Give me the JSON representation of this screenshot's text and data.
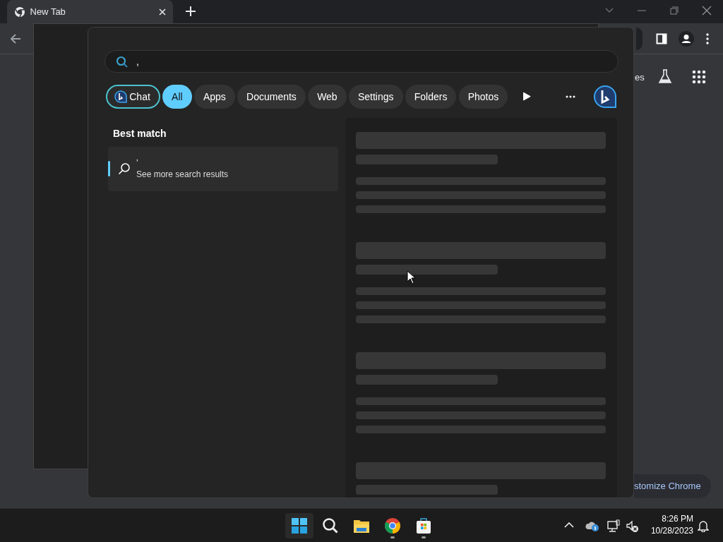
{
  "browser": {
    "tabs": [
      {
        "title": "New Tab",
        "selected": true
      }
    ],
    "partial_label": "es",
    "customize_button": "stomize Chrome"
  },
  "search": {
    "query": ",",
    "filters": [
      {
        "label": "Chat",
        "kind": "chat",
        "selected": false
      },
      {
        "label": "All",
        "kind": "plain",
        "selected": true
      },
      {
        "label": "Apps",
        "kind": "plain",
        "selected": false
      },
      {
        "label": "Documents",
        "kind": "plain",
        "selected": false
      },
      {
        "label": "Web",
        "kind": "plain",
        "selected": false
      },
      {
        "label": "Settings",
        "kind": "plain",
        "selected": false
      },
      {
        "label": "Folders",
        "kind": "plain",
        "selected": false
      },
      {
        "label": "Photos",
        "kind": "plain",
        "selected": false
      }
    ],
    "best_match_heading": "Best match",
    "result": {
      "title": "’",
      "subtitle": "See more search results",
      "selected": true
    },
    "preview_loading": true
  },
  "taskbar": {
    "apps": [
      {
        "kind": "start",
        "running": false
      },
      {
        "kind": "search",
        "running": false
      },
      {
        "kind": "explorer",
        "running": false
      },
      {
        "kind": "chrome",
        "running": true
      },
      {
        "kind": "store",
        "running": true
      }
    ],
    "time": "8:26 PM",
    "date": "10/28/2023"
  }
}
